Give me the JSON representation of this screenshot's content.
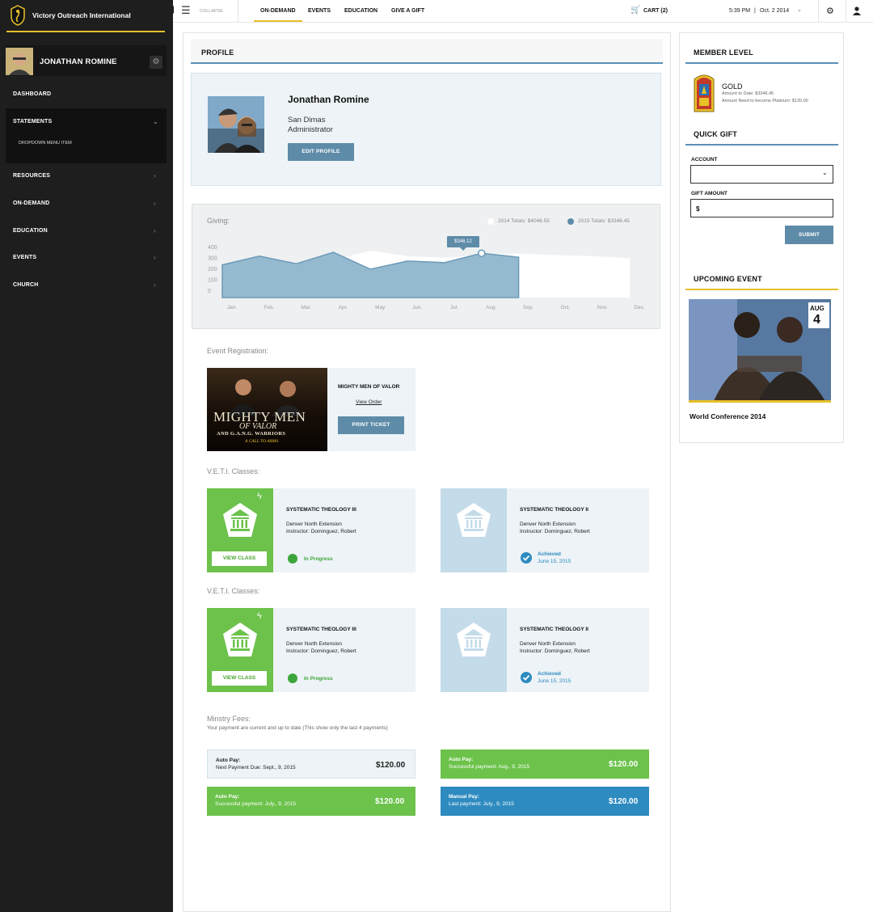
{
  "brand": {
    "name": "Victory Outreach International"
  },
  "user": {
    "name": "JONATHAN ROMINE"
  },
  "nav": {
    "items": [
      {
        "label": "DASHBOARD"
      },
      {
        "label": "STATEMENTS"
      },
      {
        "label": "RESOURCES"
      },
      {
        "label": "ON-DEMAND"
      },
      {
        "label": "EDUCATION"
      },
      {
        "label": "EVENTS"
      },
      {
        "label": "CHURCH"
      }
    ],
    "sub_item": "DROPDOWN MENU ITEM"
  },
  "topbar": {
    "collapse": "COLLAPSE",
    "tabs": [
      "ON-DEMAND",
      "EVENTS",
      "EDUCATION",
      "GIVE A GIFT"
    ],
    "cart": "CART (2)",
    "time": "5:39 PM",
    "date": "Oct. 2 2014",
    "separator": "|"
  },
  "profile": {
    "heading": "PROFILE",
    "name": "Jonathan Romine",
    "city": "San Dimas",
    "role": "Administrator",
    "edit_button": "EDIT PROFILE"
  },
  "giving": {
    "title": "Giving:",
    "legend_2014": "2014 Totals: $4046.55",
    "legend_2015": "2015 Totals: $3346.45",
    "tooltip": "$346.12"
  },
  "chart_data": {
    "type": "area",
    "title": "Giving:",
    "categories": [
      "Jan.",
      "Feb.",
      "Mar.",
      "Apr.",
      "May",
      "Jun.",
      "Jul.",
      "Aug.",
      "Sep.",
      "Oct.",
      "Nov.",
      "Dec."
    ],
    "yticks": [
      "400",
      "300",
      "200",
      "100",
      "0"
    ],
    "ylim": [
      0,
      400
    ],
    "series": [
      {
        "name": "2014 Totals: $4046.55",
        "color": "#ffffff",
        "values": [
          240,
          280,
          250,
          285,
          370,
          320,
          305,
          335,
          345,
          330,
          320,
          300
        ]
      },
      {
        "name": "2015 Totals: $3346.45",
        "color": "#8fb6cc",
        "values": [
          240,
          320,
          250,
          355,
          200,
          275,
          260,
          346.12,
          310
        ]
      }
    ],
    "grid": false,
    "legend": "top-right"
  },
  "event_registration": {
    "title": "Event Registration:",
    "event_name": "MIGHTY MEN OF VALOR",
    "view_order": "View Order",
    "print_button": "PRINT TICKET",
    "poster_line1": "MIGHTY MEN",
    "poster_line2": "OF VALOR",
    "poster_line3": "AND G.A.N.G. WARRIORS",
    "poster_line4": "A CALL TO ARMS"
  },
  "veti_sections": [
    {
      "title": "V.E.T.I. Classes:",
      "classes": [
        {
          "name": "SYSTEMATIC THEOLOGY III",
          "location": "Denver North Extension",
          "instructor": "Instructor:  Dominguez, Robert",
          "status": "In Progress",
          "button": "VIEW CLASS"
        },
        {
          "name": "SYSTEMATIC THEOLOGY II",
          "location": "Denver North Extension",
          "instructor": "Instructor:  Dominguez, Robert",
          "status": "Achieved",
          "date": "June 15, 2015"
        }
      ]
    },
    {
      "title": "V.E.T.I. Classes:",
      "classes": [
        {
          "name": "SYSTEMATIC THEOLOGY III",
          "location": "Denver North Extension",
          "instructor": "Instructor:  Dominguez, Robert",
          "status": "In Progress",
          "button": "VIEW CLASS"
        },
        {
          "name": "SYSTEMATIC THEOLOGY II",
          "location": "Denver North Extension",
          "instructor": "Instructor:  Dominguez, Robert",
          "status": "Achieved",
          "date": "June 15, 2015"
        }
      ]
    }
  ],
  "fees": {
    "title": "Minstry Fees:",
    "subtitle": "Your payment are current and up to date (This show only the last 4 payments)",
    "payments": [
      {
        "label": "Auto Pay:",
        "detail": "Next Payment Due: Sept., 9, 2015",
        "amount": "$120.00"
      },
      {
        "label": "Auto Pay:",
        "detail": "Successful payment: Aug., 9, 2015",
        "amount": "$120.00"
      },
      {
        "label": "Auto Pay:",
        "detail": "Successful payment: July., 9, 2015",
        "amount": "$120.00"
      },
      {
        "label": "Manual Pay:",
        "detail": "Last payment: July., 9, 2015",
        "amount": "$120.00"
      }
    ]
  },
  "member": {
    "heading": "MEMBER LEVEL",
    "level": "GOLD",
    "to_date": "Amount to Date: $3346.45",
    "need": "Amount Need to become Platinum: $120.00"
  },
  "quick_gift": {
    "heading": "QUICK GIFT",
    "account_label": "ACCOUNT",
    "amount_label": "GIFT AMOUNT",
    "amount_value": "$",
    "submit": "SUBMIT"
  },
  "upcoming": {
    "heading": "UPCOMING EVENT",
    "month": "AUG",
    "day": "4",
    "name": "World Conference 2014"
  },
  "colors": {
    "sidebar": "#1e1e1e",
    "gold": "#e8c028",
    "steel": "#5e8ba8",
    "green": "#6cc24a",
    "blue": "#2e8bc0"
  }
}
